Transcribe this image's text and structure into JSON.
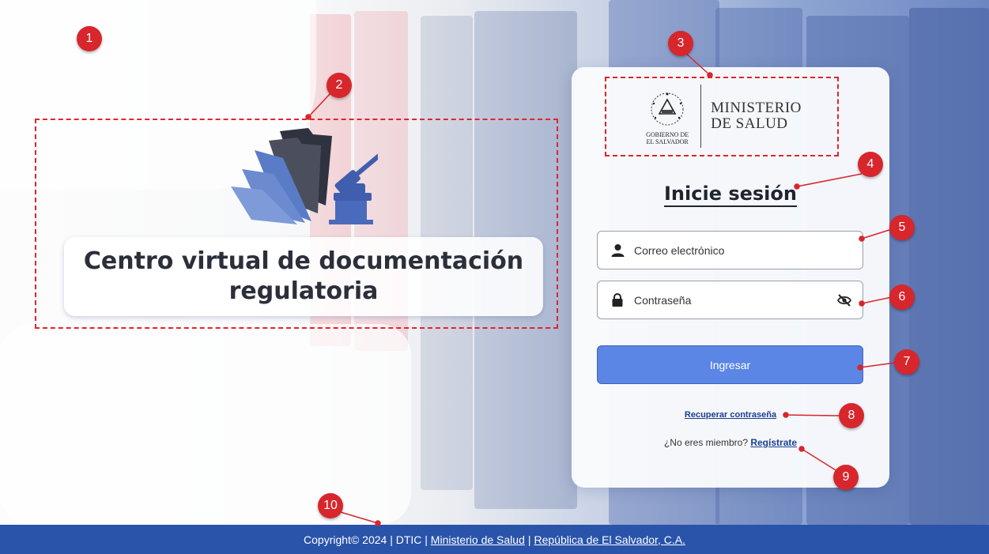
{
  "brand": {
    "title": "Centro virtual de documentación regulatoria",
    "logo_icon": "folders-gavel-icon"
  },
  "login": {
    "ministry_gov_line1": "GOBIERNO DE",
    "ministry_gov_line2": "EL SALVADOR",
    "ministry_name_line1": "MINISTERIO",
    "ministry_name_line2": "DE SALUD",
    "heading": "Inicie sesión",
    "email_placeholder": "Correo electrónico",
    "password_placeholder": "Contraseña",
    "submit_label": "Ingresar",
    "recover_label": "Recuperar contraseña",
    "signup_prompt": "¿No eres miembro?",
    "signup_label": "Regístrate"
  },
  "footer": {
    "copyright": "Copyright© 2024 |  DTIC |",
    "link_ministry": "Ministerio de Salud",
    "separator": "|",
    "link_country": "República de El Salvador, C.A."
  },
  "annotations": [
    "1",
    "2",
    "3",
    "4",
    "5",
    "6",
    "7",
    "8",
    "9",
    "10"
  ],
  "colors": {
    "primary_button": "#5b86e6",
    "footer_bg": "#2a53aa",
    "annotation_red": "#d7262c",
    "link": "#1d3f8f"
  }
}
